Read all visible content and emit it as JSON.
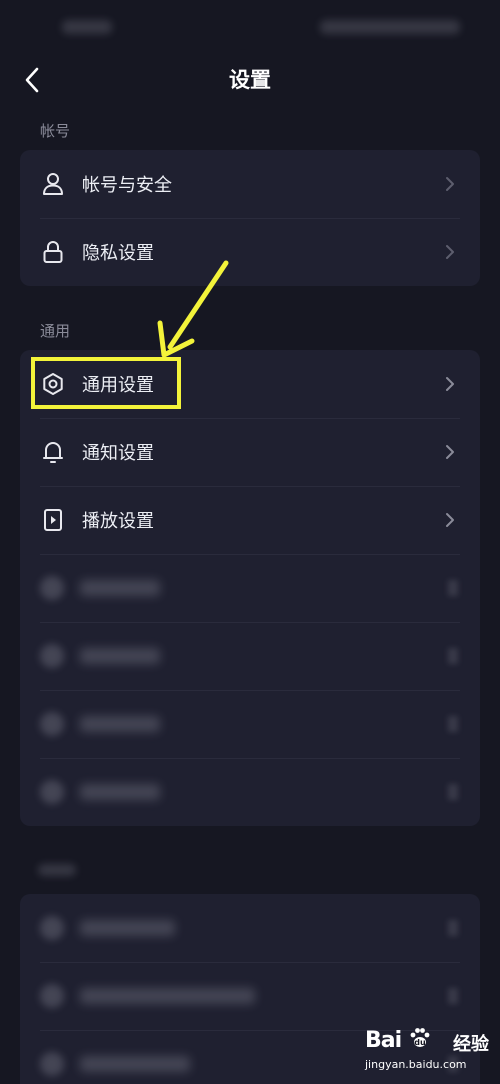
{
  "header": {
    "title": "设置"
  },
  "sections": [
    {
      "label": "帐号",
      "items": [
        {
          "label": "帐号与安全",
          "icon": "user-icon"
        },
        {
          "label": "隐私设置",
          "icon": "lock-icon"
        }
      ]
    },
    {
      "label": "通用",
      "items": [
        {
          "label": "通用设置",
          "icon": "gear-icon"
        },
        {
          "label": "通知设置",
          "icon": "bell-icon"
        },
        {
          "label": "播放设置",
          "icon": "play-device-icon"
        }
      ]
    }
  ],
  "watermark": {
    "logo": "Bai",
    "logo2": "经验",
    "url": "jingyan.baidu.com"
  },
  "colors": {
    "background": "#161722",
    "card": "#1f2030",
    "highlight": "#f3f33a",
    "section_label": "#8a8b99"
  }
}
